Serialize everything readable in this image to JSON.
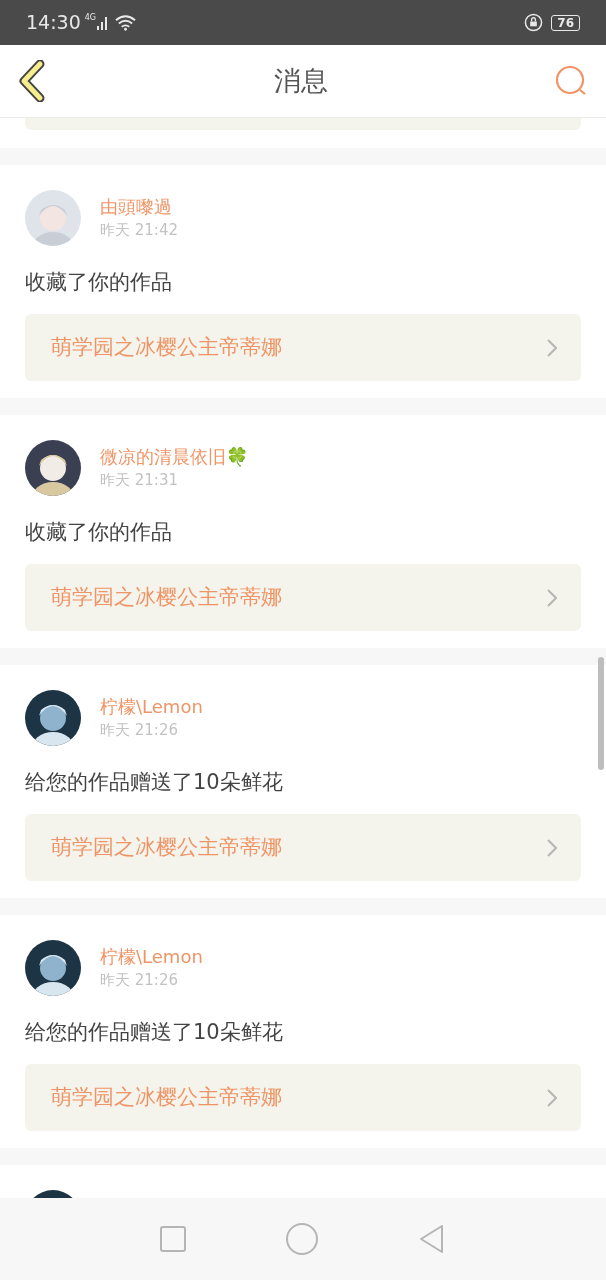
{
  "status_bar": {
    "time": "14:30",
    "network": "4G",
    "battery": "76"
  },
  "header": {
    "title": "消息"
  },
  "messages": [
    {
      "user": "由頭嚟過",
      "time": "昨天 21:42",
      "action": "收藏了你的作品",
      "work": "萌学园之冰樱公主帝蒂娜"
    },
    {
      "user": "微凉的清晨依旧🍀",
      "time": "昨天 21:31",
      "action": "收藏了你的作品",
      "work": "萌学园之冰樱公主帝蒂娜"
    },
    {
      "user": "柠檬\\Lemon",
      "time": "昨天 21:26",
      "action": "给您的作品赠送了10朵鲜花",
      "work": "萌学园之冰樱公主帝蒂娜"
    },
    {
      "user": "柠檬\\Lemon",
      "time": "昨天 21:26",
      "action": "给您的作品赠送了10朵鲜花",
      "work": "萌学园之冰樱公主帝蒂娜"
    }
  ]
}
